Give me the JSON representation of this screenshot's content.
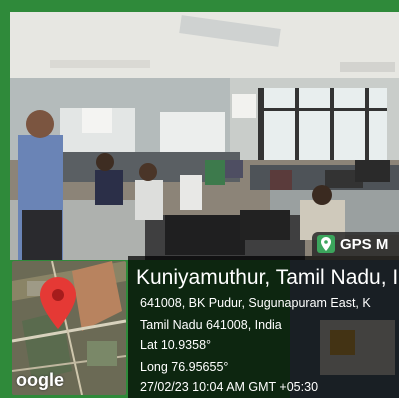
{
  "badge": {
    "label": "GPS M",
    "icon": "map-pin-icon"
  },
  "map": {
    "logo_text": "oogle",
    "pin_color": "#e53935"
  },
  "info": {
    "title": "Kuniyamuthur, Tamil Nadu, In",
    "address_1": "641008, BK Pudur, Sugunapuram East, K",
    "address_2": "Tamil Nadu 641008, India",
    "lat": "Lat 10.9358°",
    "long": "Long 76.95655°",
    "datetime": "27/02/23 10:04 AM GMT +05:30"
  },
  "colors": {
    "frame_green": "#2f8a3a",
    "panel_bg": "rgba(0,0,0,0.72)"
  }
}
